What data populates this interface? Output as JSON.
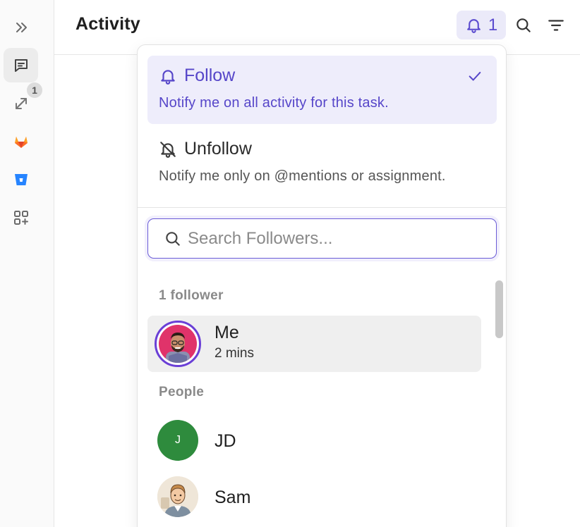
{
  "header": {
    "title": "Activity",
    "follower_count": "1"
  },
  "rail": {
    "sync_badge": "1"
  },
  "follow_menu": {
    "follow": {
      "label": "Follow",
      "description": "Notify me on all activity for this task.",
      "selected": true
    },
    "unfollow": {
      "label": "Unfollow",
      "description": "Notify me only on @mentions or assignment."
    },
    "search": {
      "placeholder": "Search Followers..."
    },
    "followers_label": "1 follower",
    "followers": [
      {
        "name": "Me",
        "subtitle": "2 mins"
      }
    ],
    "people_label": "People",
    "people": [
      {
        "name": "JD",
        "initial": "J"
      },
      {
        "name": "Sam"
      }
    ]
  },
  "colors": {
    "accent": "#5b4bcf",
    "selected_bg": "#eeedfb",
    "avatar_green": "#2e8b3d"
  },
  "icons": [
    "expand-icon",
    "comment-icon",
    "sync-icon",
    "gitlab-icon",
    "bitbucket-icon",
    "apps-add-icon",
    "bell-icon",
    "search-icon",
    "filter-icon",
    "check-icon",
    "bell-off-icon"
  ]
}
